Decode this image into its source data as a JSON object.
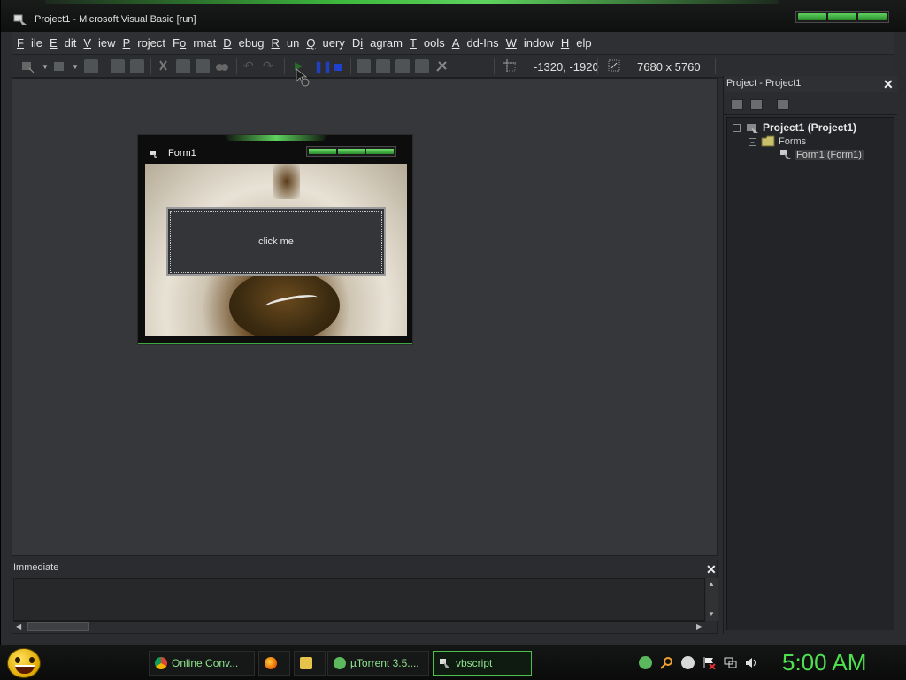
{
  "window": {
    "title": "Project1 - Microsoft Visual Basic [run]"
  },
  "menu": [
    {
      "label": "File",
      "accel": "F",
      "rest": "ile"
    },
    {
      "label": "Edit",
      "accel": "E",
      "rest": "dit"
    },
    {
      "label": "View",
      "accel": "V",
      "rest": "iew"
    },
    {
      "label": "Project",
      "accel": "P",
      "rest": "roject"
    },
    {
      "label": "Format",
      "accel": "o",
      "pre": "F",
      "rest": "rmat"
    },
    {
      "label": "Debug",
      "accel": "D",
      "rest": "ebug"
    },
    {
      "label": "Run",
      "accel": "R",
      "rest": "un"
    },
    {
      "label": "Query",
      "accel": "Q",
      "rest": "uery"
    },
    {
      "label": "Diagram",
      "accel": "i",
      "pre": "D",
      "rest": "agram"
    },
    {
      "label": "Tools",
      "accel": "T",
      "rest": "ools"
    },
    {
      "label": "Add-Ins",
      "accel": "A",
      "rest": "dd-Ins"
    },
    {
      "label": "Window",
      "accel": "W",
      "rest": "indow"
    },
    {
      "label": "Help",
      "accel": "H",
      "rest": "elp"
    }
  ],
  "toolbar": {
    "position": "-1320, -1920",
    "size": "7680 x 5760"
  },
  "form1": {
    "title": "Form1",
    "button_label": "click me"
  },
  "project_panel": {
    "title": "Project - Project1",
    "tree": {
      "root": "Project1 (Project1)",
      "folder": "Forms",
      "item": "Form1 (Form1)"
    }
  },
  "immediate": {
    "title": "Immediate"
  },
  "taskbar": {
    "tasks": [
      "Online Conv...",
      "",
      "",
      "µTorrent 3.5....",
      "vbscript"
    ],
    "clock": "5:00 AM"
  },
  "colors": {
    "accent_green": "#4fe04f",
    "background": "#35373a"
  }
}
